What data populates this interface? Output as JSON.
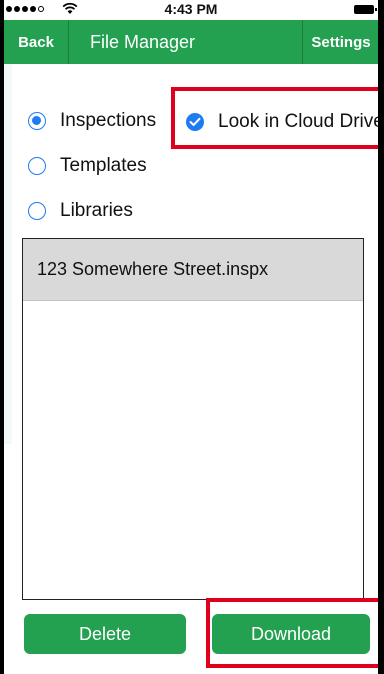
{
  "status_bar": {
    "time": "4:43 PM"
  },
  "nav": {
    "back_label": "Back",
    "title": "File Manager",
    "settings_label": "Settings"
  },
  "options": {
    "inspections_label": "Inspections",
    "inspections_selected": true,
    "templates_label": "Templates",
    "templates_selected": false,
    "libraries_label": "Libraries",
    "libraries_selected": false,
    "cloud_label": "Look in Cloud Drive",
    "cloud_checked": true
  },
  "files": {
    "items": [
      {
        "name": "123 Somewhere Street.inspx",
        "selected": true
      }
    ]
  },
  "actions": {
    "delete_label": "Delete",
    "download_label": "Download"
  },
  "colors": {
    "accent_green": "#23a050",
    "ios_blue": "#1e7cf2",
    "highlight_red": "#e0001b",
    "selected_row": "#d9d9d9"
  }
}
